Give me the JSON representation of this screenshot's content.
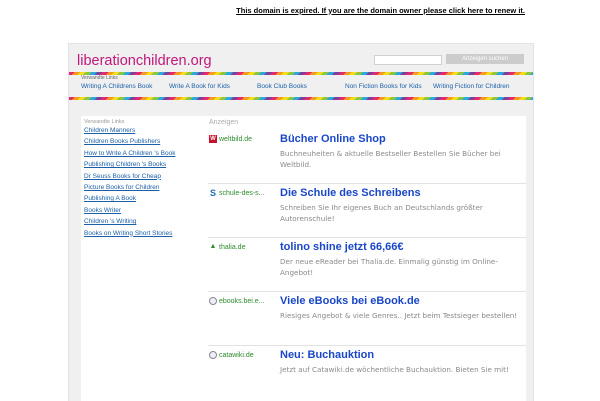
{
  "topbar": {
    "notice": "This domain is expired. If you are the domain owner please click here to renew it."
  },
  "header": {
    "site_title": "liberationchildren.org",
    "search_value": "",
    "search_button": "Anzeigen suchen"
  },
  "top_links": {
    "label": "Verwandte Links",
    "items": [
      "Writing A Childrens Book",
      "Write A Book for Kids",
      "Book Club Books",
      "Non Fiction Books for Kids",
      "Writing Fiction for Children"
    ]
  },
  "sidebar": {
    "label": "Verwandte Links",
    "items": [
      "Children Manners",
      "Children Books Publishers",
      "How to Write A Children 's Book",
      "Publishing Children 's Books",
      "Dr Seuss Books for Cheap",
      "Picture Books for Children",
      "Publishing A Book",
      "Books Writer",
      "Children 's Writing",
      "Books on Writing Short Stories"
    ]
  },
  "ads": {
    "label": "Anzeigen",
    "items": [
      {
        "source": "weltbild.de",
        "icon": "weltbild-favicon",
        "title": "Bücher Online Shop",
        "description": "Buchneuheiten & aktuelle Bestseller Bestellen Sie Bücher bei Weltbild."
      },
      {
        "source": "schule-des-s...",
        "icon": "schule-favicon",
        "title": "Die Schule des Schreibens",
        "description": "Schreiben Sie Ihr eigenes Buch an Deutschlands größter Autorenschule!"
      },
      {
        "source": "thalia.de",
        "icon": "thalia-favicon",
        "title": "tolino shine jetzt 66,66€",
        "description": "Der neue eReader bei Thalia.de. Einmalig günstig im Online-Angebot!"
      },
      {
        "source": "ebooks.bei.e...",
        "icon": "ebook-favicon",
        "title": "Viele eBooks bei eBook.de",
        "description": "Riesiges Angebot & viele Genres.. Jetzt beim Testsieger bestellen!"
      },
      {
        "source": "catawiki.de",
        "icon": "catawiki-favicon",
        "title": "Neu: Buchauktion",
        "description": "Jetzt auf Catawiki.de wöchentliche Buchauktion. Bieten Sie mit!"
      }
    ]
  }
}
